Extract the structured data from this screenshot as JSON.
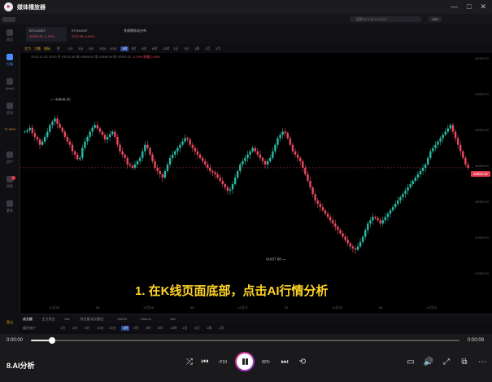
{
  "app": {
    "title": "媒体播放器"
  },
  "window_controls": [
    "—",
    "□",
    "✕"
  ],
  "video": {
    "caption": "1. 在K线页面底部，点击AI行情分析",
    "pairs": [
      {
        "name": "BTC/USDT",
        "sub": "42950.32 -1.19%"
      },
      {
        "name": "ETH/USDT",
        "sub": "2375.58 -0.89%"
      },
      {
        "name": "多周期轮动分布",
        "sub": ""
      }
    ],
    "search_placeholder": "搜索OKX-BTC/USDT",
    "currency": "USD",
    "sidebar": [
      {
        "label": "首页",
        "icon": "home-icon"
      },
      {
        "label": "行情",
        "icon": "chart-icon"
      },
      {
        "label": "Web3",
        "icon": "web3-icon"
      },
      {
        "label": "资讯",
        "icon": "news-icon"
      },
      {
        "label": "71.93%",
        "icon": "percent-icon"
      },
      {
        "label": "资产",
        "icon": "wallet-icon"
      },
      {
        "label": "消息",
        "icon": "bell-icon"
      },
      {
        "label": "更多",
        "icon": "more-icon"
      }
    ],
    "logout_label": "登出",
    "intervals": [
      "秒",
      "1分",
      "3分",
      "5分",
      "15分",
      "30分",
      "1时",
      "2时",
      "4时",
      "6时",
      "12时",
      "1日",
      "3日",
      "1周",
      "1月",
      "3月"
    ],
    "active_interval": "1时",
    "tools": [
      "主力",
      "大额",
      "指标"
    ],
    "info_line": {
      "date": "2023-12-28 15:00",
      "text": "开 43031.56  高 43068.00  低 42898.59  收 42950.32",
      "change": "-0.19%  振幅 0.40%"
    },
    "y_ticks": [
      "44000.00",
      "43500.00",
      "43000.00",
      "42500.00",
      "42000.00",
      "41500.00",
      "41000.00"
    ],
    "x_ticks": [
      "12月25",
      "06",
      "12月26",
      "06",
      "12月27",
      "06",
      "12月28",
      "06",
      "12月29"
    ],
    "last_price": "42950.32",
    "high_label": "43948.00",
    "low_label": "41637.98",
    "indicators": [
      "成交额",
      "主力资金",
      "MA",
      "持仓量/成交额比",
      "MACD",
      "Volume",
      "MA"
    ],
    "bottom_left": "委托账户",
    "bottom_intervals": [
      "1分",
      "3分",
      "5分",
      "15分",
      "30分",
      "1时",
      "2时",
      "4时",
      "6时",
      "12时",
      "1日",
      "3日",
      "1周",
      "1月"
    ],
    "bottom_selected": "1时"
  },
  "chart_data": {
    "type": "candlestick",
    "y_range": [
      41000,
      44600
    ],
    "closes": [
      43500,
      43520,
      43560,
      43480,
      43420,
      43380,
      43300,
      43350,
      43420,
      43500,
      43600,
      43650,
      43700,
      43620,
      43560,
      43500,
      43420,
      43350,
      43300,
      43200,
      43150,
      43080,
      43100,
      43250,
      43350,
      43420,
      43500,
      43560,
      43600,
      43550,
      43500,
      43450,
      43380,
      43420,
      43460,
      43500,
      43420,
      43300,
      43200,
      43150,
      43100,
      43000,
      42980,
      42950,
      43000,
      43050,
      43100,
      43200,
      43300,
      43250,
      43150,
      43050,
      42950,
      42900,
      42850,
      42800,
      42900,
      43000,
      43100,
      43150,
      43200,
      43250,
      43300,
      43350,
      43400,
      43380,
      43300,
      43250,
      43200,
      43150,
      43100,
      43050,
      43000,
      42950,
      42900,
      42880,
      42850,
      42800,
      42750,
      42700,
      42650,
      42600,
      42620,
      42700,
      42800,
      42900,
      43000,
      43050,
      43100,
      43150,
      43200,
      43250,
      43200,
      43150,
      43100,
      43050,
      43000,
      43050,
      43100,
      43200,
      43300,
      43400,
      43450,
      43500,
      43480,
      43400,
      43300,
      43200,
      43150,
      43100,
      43050,
      42950,
      42850,
      42750,
      42650,
      42550,
      42450,
      42400,
      42350,
      42300,
      42250,
      42200,
      42150,
      42100,
      42050,
      42000,
      41950,
      41900,
      41850,
      41800,
      41750,
      41720,
      41700,
      41750,
      41820,
      41900,
      42000,
      42100,
      42150,
      42200,
      42180,
      42150,
      42100,
      42150,
      42200,
      42250,
      42300,
      42350,
      42400,
      42450,
      42500,
      42550,
      42600,
      42650,
      42700,
      42750,
      42800,
      42850,
      42900,
      42950,
      43000,
      43100,
      43200,
      43250,
      43300,
      43350,
      43400,
      43450,
      43500,
      43550,
      43600,
      43500,
      43400,
      43300,
      43200,
      43100,
      43000,
      42950
    ],
    "last": 42950.32
  }
}
